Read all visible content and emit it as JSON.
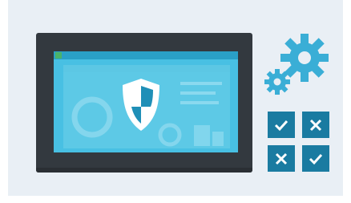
{
  "illustration": {
    "subject": "device-security-settings",
    "colors": {
      "background": "#e9eff5",
      "device_frame": "#33393f",
      "screen": "#48c0e3",
      "screen_bar": "#2aa0c7",
      "indicator": "#4ab26a",
      "shield": "#ffffff",
      "shield_dark": "#1f8fb7",
      "gear": "#3aaed6",
      "checkbox": "#1a7ba1",
      "mark": "#ffffff"
    },
    "icons": {
      "shield": "shield-icon",
      "gears": [
        "gear-large-icon",
        "gear-small-icon"
      ],
      "checkboxes": [
        {
          "state": "checked",
          "icon": "check-icon"
        },
        {
          "state": "crossed",
          "icon": "cross-icon"
        },
        {
          "state": "crossed",
          "icon": "cross-icon"
        },
        {
          "state": "checked",
          "icon": "check-icon"
        }
      ]
    }
  }
}
